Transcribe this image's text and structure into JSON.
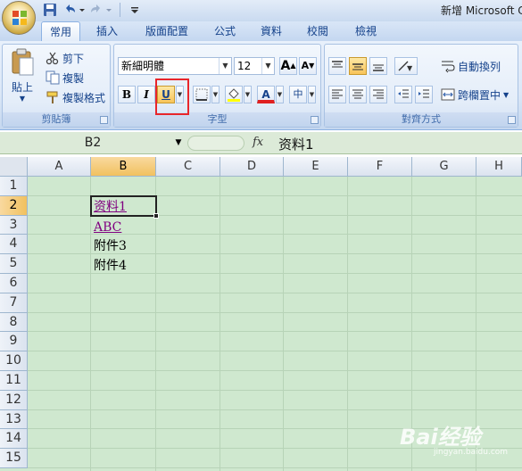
{
  "window": {
    "title": "新增 Microsoft C"
  },
  "quick_access": {
    "items": [
      "save-icon",
      "undo-icon",
      "redo-icon",
      "customize-icon"
    ]
  },
  "tabs": [
    {
      "label": "常用",
      "active": true
    },
    {
      "label": "插入"
    },
    {
      "label": "版面配置"
    },
    {
      "label": "公式"
    },
    {
      "label": "資料"
    },
    {
      "label": "校閱"
    },
    {
      "label": "檢視"
    }
  ],
  "ribbon": {
    "clipboard": {
      "paste_label": "貼上",
      "cut_label": "剪下",
      "copy_label": "複製",
      "format_painter_label": "複製格式",
      "group_label": "剪貼簿"
    },
    "font": {
      "font_name": "新細明體",
      "font_size": "12",
      "bold_label": "B",
      "italic_label": "I",
      "underline_label": "U",
      "grow_label": "A",
      "shrink_label": "A",
      "font_color_label": "A",
      "phonetic_label": "中",
      "group_label": "字型"
    },
    "alignment": {
      "wrap_label": "自動換列",
      "merge_label": "跨欄置中",
      "group_label": "對齊方式"
    }
  },
  "formula_bar": {
    "name_box": "B2",
    "fx_label": "fx",
    "value": "资料1"
  },
  "sheet": {
    "columns": [
      "A",
      "B",
      "C",
      "D",
      "E",
      "F",
      "G",
      "H"
    ],
    "rows": [
      "1",
      "2",
      "3",
      "4",
      "5",
      "6",
      "7",
      "8",
      "9",
      "10",
      "11",
      "12",
      "13",
      "14",
      "15"
    ],
    "selected_cell": "B2",
    "cells": {
      "B2": "资料1",
      "B3": "ABC",
      "B4": "附件3",
      "B5": "附件4"
    }
  },
  "watermark": {
    "text": "Bai经验",
    "sub": "jingyan.baidu.com"
  },
  "colors": {
    "sheet_bg": "#cfe8cf",
    "highlight_box": "#e8262b",
    "hyperlink": "#800080",
    "selected_header": "#f1c15f"
  }
}
